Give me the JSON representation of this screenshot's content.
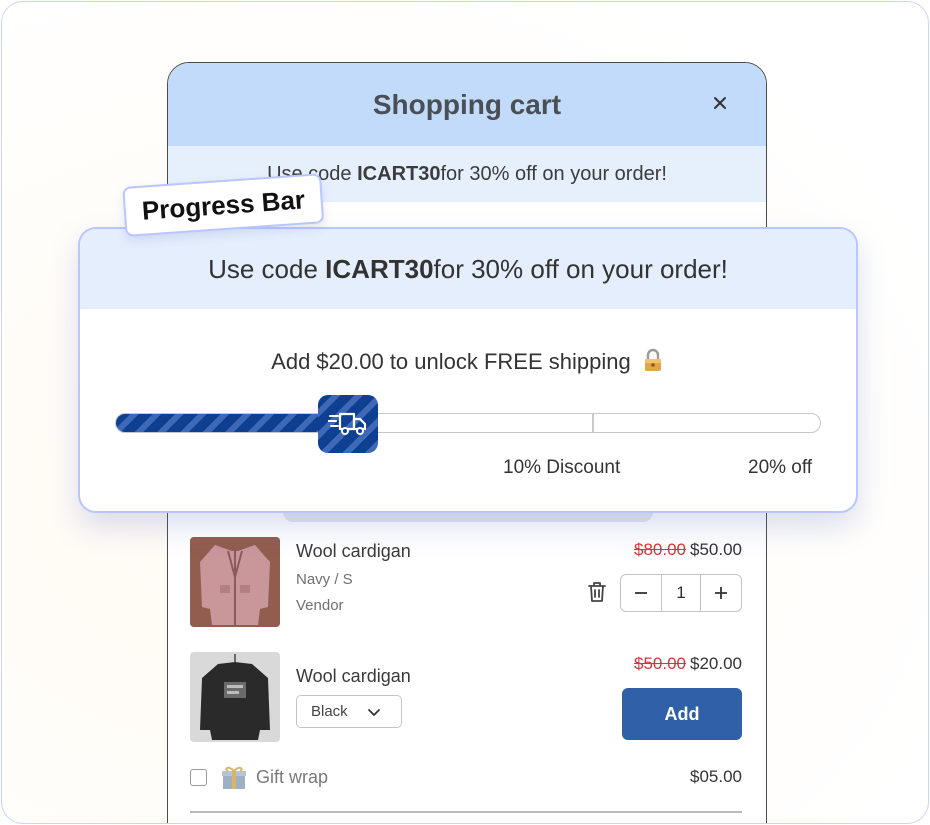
{
  "cart": {
    "title": "Shopping cart",
    "promo": {
      "prefix": "Use code ",
      "code": "ICART30",
      "suffix": " for 30% off on your order!"
    },
    "items": [
      {
        "name": "Wool cardigan",
        "variant": "Navy / S",
        "vendor": "Vendor",
        "original_price": "$80.00",
        "sale_price": "$50.00",
        "quantity": "1",
        "minus_label": "−",
        "plus_label": "+"
      },
      {
        "name": "Wool cardigan",
        "selected_option": "Black",
        "original_price": "$50.00",
        "sale_price": "$20.00",
        "add_label": "Add"
      }
    ],
    "gift_wrap": {
      "label": "Gift wrap",
      "price": "$05.00",
      "checked": false
    }
  },
  "tag": {
    "label": "Progress Bar"
  },
  "progress": {
    "promo": {
      "prefix": "Use code ",
      "code": "ICART30",
      "suffix": " for 30% off on your order!"
    },
    "message": "Add $20.00 to unlock FREE shipping",
    "fill_fraction": 0.33,
    "milestones": [
      {
        "label": "",
        "icon": "delivery-truck-icon",
        "at": 0.33
      },
      {
        "label": "10% Discount",
        "at": 0.676
      },
      {
        "label": "20% off",
        "at": 1.0
      }
    ]
  },
  "colors": {
    "header_bg": "#c3dbfb",
    "promo_bg": "#e4eefc",
    "progress_fill": "#0e3f91",
    "add_button": "#2f60a8",
    "strike_price": "#d9333a",
    "card_border": "#b9c6ff"
  }
}
